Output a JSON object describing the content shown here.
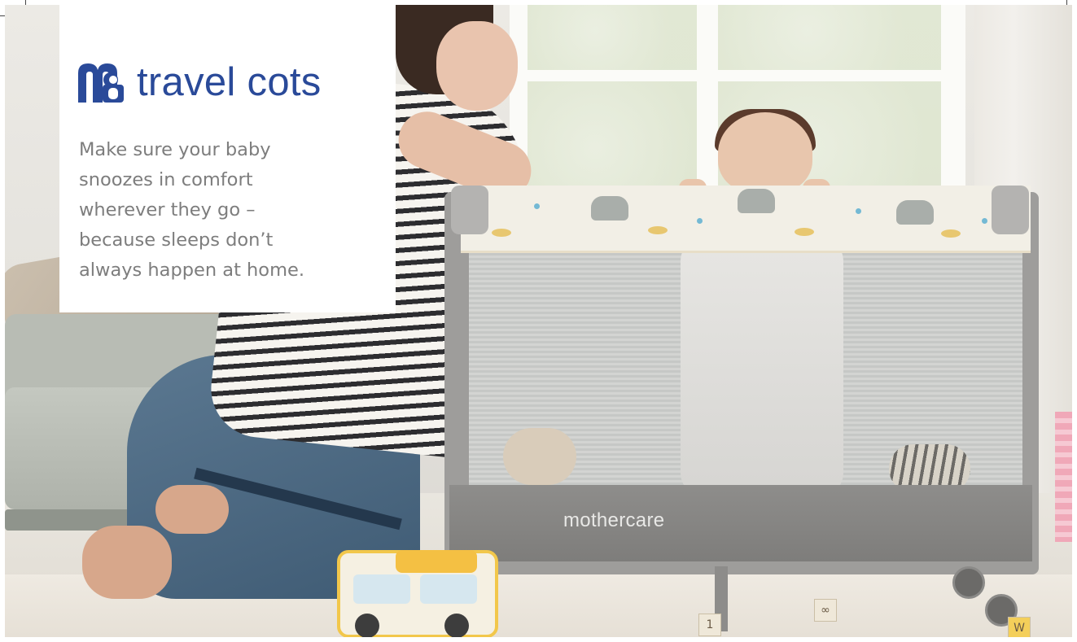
{
  "card": {
    "headline": "travel cots",
    "body": "Make sure your baby\nsnoozes in comfort\nwherever they go –\nbecause sleeps don’t\nalways happen at home.",
    "logo_icon": "mothercare-logo-icon"
  },
  "product": {
    "brand_label": "mothercare"
  },
  "toys": {
    "block_1": "1",
    "block_2": "∞",
    "block_3": "W"
  },
  "colors": {
    "brand_blue": "#2a4a99",
    "body_text": "#7d7d7d",
    "card_bg": "#ffffff"
  }
}
